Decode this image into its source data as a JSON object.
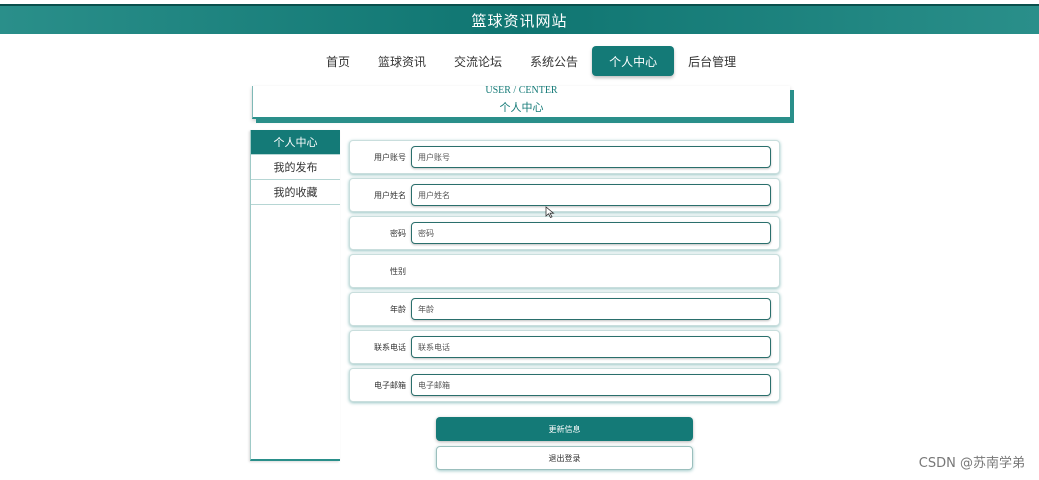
{
  "header": {
    "title": "篮球资讯网站"
  },
  "nav": {
    "items": [
      "首页",
      "篮球资讯",
      "交流论坛",
      "系统公告",
      "个人中心",
      "后台管理"
    ],
    "active_index": 4
  },
  "title_box": {
    "en": "USER / CENTER",
    "zh": "个人中心"
  },
  "side_menu": {
    "items": [
      "个人中心",
      "我的发布",
      "我的收藏"
    ],
    "active_index": 0
  },
  "form": {
    "fields": [
      {
        "label": "用户账号",
        "placeholder": "用户账号",
        "value": ""
      },
      {
        "label": "用户姓名",
        "placeholder": "用户姓名",
        "value": ""
      },
      {
        "label": "密码",
        "placeholder": "密码",
        "value": ""
      },
      {
        "label": "性别"
      },
      {
        "label": "年龄",
        "placeholder": "年龄",
        "value": ""
      },
      {
        "label": "联系电话",
        "placeholder": "联系电话",
        "value": ""
      },
      {
        "label": "电子邮箱",
        "placeholder": "电子邮箱",
        "value": ""
      }
    ],
    "update_label": "更新信息",
    "logout_label": "退出登录"
  },
  "watermark": "CSDN @苏南学弟",
  "colors": {
    "primary": "#147a77",
    "header": "#0f7571"
  },
  "icons": {
    "cursor": "mouse-pointer-icon"
  }
}
